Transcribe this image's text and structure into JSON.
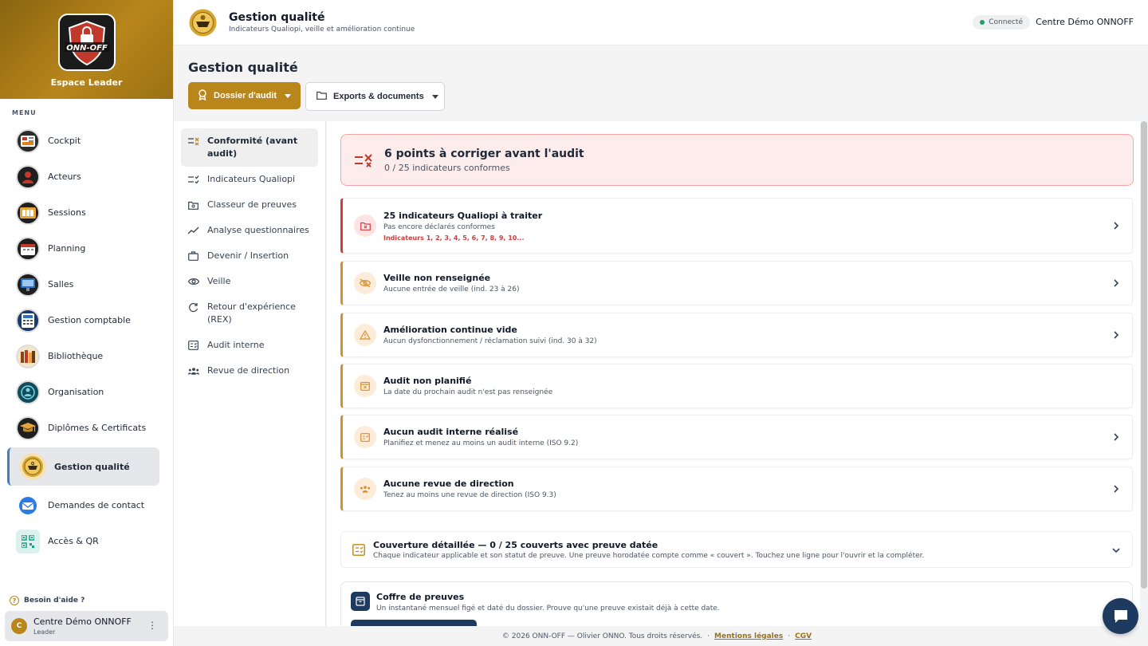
{
  "sidebar": {
    "brand_title": "Espace Leader",
    "logo_text": "ONN-OFF",
    "menu_label": "MENU",
    "items": [
      {
        "label": "Cockpit",
        "icon": "dashboard-icon"
      },
      {
        "label": "Acteurs",
        "icon": "people-icon"
      },
      {
        "label": "Sessions",
        "icon": "sessions-icon"
      },
      {
        "label": "Planning",
        "icon": "calendar-icon"
      },
      {
        "label": "Salles",
        "icon": "rooms-icon"
      },
      {
        "label": "Gestion comptable",
        "icon": "accounting-icon"
      },
      {
        "label": "Bibliothèque",
        "icon": "library-icon"
      },
      {
        "label": "Organisation",
        "icon": "organisation-icon"
      },
      {
        "label": "Diplômes & Certificats",
        "icon": "diploma-icon"
      },
      {
        "label": "Gestion qualité",
        "icon": "quality-medal-icon",
        "active": true
      },
      {
        "label": "Demandes de contact",
        "icon": "contact-icon"
      },
      {
        "label": "Accès & QR",
        "icon": "qr-code-icon"
      }
    ],
    "help_label": "Besoin d'aide ?",
    "user": {
      "initial": "C",
      "name": "Centre Démo ONNOFF",
      "role": "Leader"
    }
  },
  "header": {
    "title": "Gestion qualité",
    "subtitle": "Indicateurs Qualiopi, veille et amélioration continue",
    "status": "Connecté",
    "org_name": "Centre Démo ONNOFF"
  },
  "page": {
    "title": "Gestion qualité",
    "primary_button": "Dossier d'audit",
    "secondary_button": "Exports & documents"
  },
  "subnav": [
    {
      "label": "Conformité (avant audit)",
      "icon": "checklist-x-icon",
      "active": true
    },
    {
      "label": "Indicateurs Qualiopi",
      "icon": "checklist-icon"
    },
    {
      "label": "Classeur de preuves",
      "icon": "folder-icon"
    },
    {
      "label": "Analyse questionnaires",
      "icon": "trend-icon"
    },
    {
      "label": "Devenir / Insertion",
      "icon": "briefcase-icon"
    },
    {
      "label": "Veille",
      "icon": "eye-icon"
    },
    {
      "label": "Retour d'expérience (REX)",
      "icon": "refresh-icon"
    },
    {
      "label": "Audit interne",
      "icon": "audit-icon"
    },
    {
      "label": "Revue de direction",
      "icon": "group-icon"
    }
  ],
  "alert": {
    "title": "6 points à corriger avant l'audit",
    "subtitle": "0 / 25 indicateurs conformes"
  },
  "tasks": [
    {
      "title": "25 indicateurs Qualiopi à traiter",
      "subtitle": "Pas encore déclarés conformes",
      "detail": "Indicateurs 1, 2, 3, 4, 5, 6, 7, 8, 9, 10...",
      "icon": "folder-x-icon",
      "severity": "red"
    },
    {
      "title": "Veille non renseignée",
      "subtitle": "Aucune entrée de veille (ind. 23 à 26)",
      "icon": "eye-off-icon",
      "severity": "orange"
    },
    {
      "title": "Amélioration continue vide",
      "subtitle": "Aucun dysfonctionnement / réclamation suivi (ind. 30 à 32)",
      "icon": "warning-icon",
      "severity": "orange"
    },
    {
      "title": "Audit non planifié",
      "subtitle": "La date du prochain audit n'est pas renseignée",
      "icon": "calendar-x-icon",
      "severity": "orange"
    },
    {
      "title": "Aucun audit interne réalisé",
      "subtitle": "Planifiez et menez au moins un audit interne (ISO 9.2)",
      "icon": "audit-icon",
      "severity": "orange"
    },
    {
      "title": "Aucune revue de direction",
      "subtitle": "Tenez au moins une revue de direction (ISO 9.3)",
      "icon": "group-icon",
      "severity": "orange"
    }
  ],
  "coverage": {
    "title": "Couverture détaillée — 0 / 25 couverts avec preuve datée",
    "subtitle": "Chaque indicateur applicable et son statut de preuve. Une preuve horodatée compte comme « couvert ». Touchez une ligne pour l'ouvrir et la compléter."
  },
  "vault": {
    "title": "Coffre de preuves",
    "subtitle": "Un instantané mensuel figé et daté du dossier. Prouve qu'une preuve existait déjà à cette date."
  },
  "footer": {
    "copyright": "© 2026 ONN-OFF — Olivier ONNO. Tous droits réservés.",
    "sep": "·",
    "legal": "Mentions légales",
    "cgv": "CGV"
  },
  "colors": {
    "accent": "#b8861b",
    "danger": "#d63b3b",
    "warning": "#d98f2b",
    "navy": "#1e3a5f",
    "success": "#22a06b"
  }
}
